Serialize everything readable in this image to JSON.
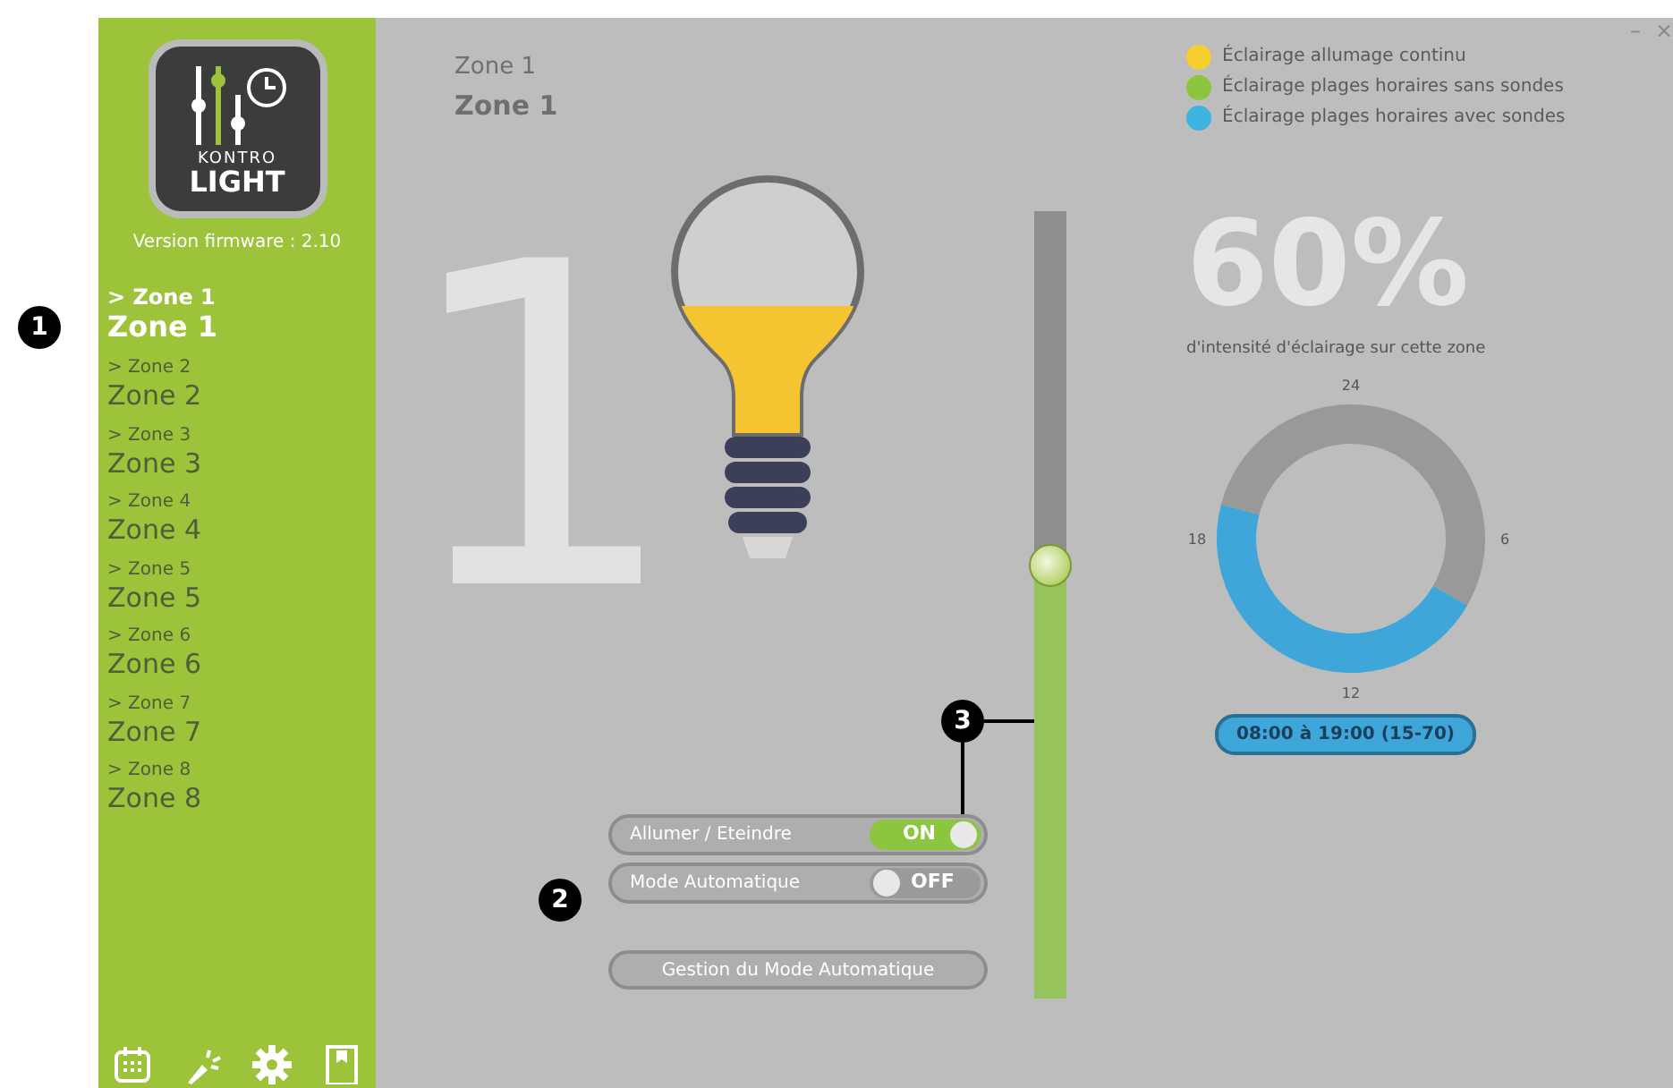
{
  "app": {
    "logo_text": "KONTRO",
    "logo_text_2": "LIGHT",
    "firmware": "Version firmware : 2.10"
  },
  "sidebar": {
    "items": [
      {
        "label": "> Zone 1",
        "name": "Zone 1",
        "selected": true
      },
      {
        "label": "> Zone 2",
        "name": "Zone 2",
        "selected": false
      },
      {
        "label": "> Zone 3",
        "name": "Zone 3",
        "selected": false
      },
      {
        "label": "> Zone 4",
        "name": "Zone 4",
        "selected": false
      },
      {
        "label": "> Zone 5",
        "name": "Zone 5",
        "selected": false
      },
      {
        "label": "> Zone 6",
        "name": "Zone 6",
        "selected": false
      },
      {
        "label": "> Zone 7",
        "name": "Zone 7",
        "selected": false
      },
      {
        "label": "> Zone 8",
        "name": "Zone 8",
        "selected": false
      }
    ],
    "tools": [
      {
        "kind": "calendar"
      },
      {
        "kind": "wand"
      },
      {
        "kind": "settings"
      },
      {
        "kind": "bookmark"
      }
    ]
  },
  "window": {
    "controls": [
      "–",
      "×"
    ]
  },
  "header": {
    "label": "Zone 1",
    "title": "Zone 1",
    "big_number": "1"
  },
  "bulb": {
    "level": 0.5
  },
  "intensity_slider": {
    "level": 0.55
  },
  "toggles": [
    {
      "label": "Allumer / Eteindre",
      "on": true,
      "state_text": "ON"
    },
    {
      "label": "Mode Automatique",
      "on": false,
      "state_text": "OFF"
    }
  ],
  "button": "Gestion du Mode Automatique",
  "legend": [
    {
      "label": "Éclairage allumage continu",
      "color": "#f5cf2e"
    },
    {
      "label": "Éclairage plages horaires sans sondes",
      "color": "#8cc63e"
    },
    {
      "label": "Éclairage plages horaires avec sondes",
      "color": "#3fb3e0"
    }
  ],
  "intensity": {
    "value": "60%",
    "caption": "d'intensité d'éclairage sur cette zone"
  },
  "schedule": {
    "chart_data": {
      "type": "donut",
      "values": [
        33.3,
        45.8,
        20.9
      ],
      "colors": [
        "#999999",
        "#3ea6d9",
        "#999999"
      ]
    },
    "dial_labels": [
      "24",
      "6",
      "12",
      "18"
    ],
    "range": "08:00 à 19:00 (15-70)"
  },
  "callouts": [
    "1",
    "2",
    "3"
  ]
}
